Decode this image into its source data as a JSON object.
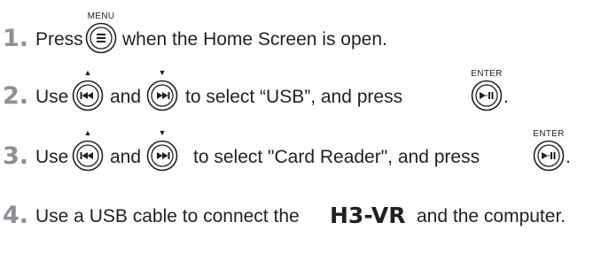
{
  "steps": [
    {
      "number": "1.",
      "text_a": "Press",
      "text_b": "when the Home Screen is open.",
      "button_label": "MENU"
    },
    {
      "number": "2.",
      "text_a": "Use",
      "text_b": "and",
      "text_c": "to select “USB”, and press",
      "text_d": ".",
      "button_label": "ENTER"
    },
    {
      "number": "3.",
      "text_a": "Use",
      "text_b": "and",
      "text_c": "to select \"Card Reader\", and press",
      "text_d": ".",
      "button_label": "ENTER"
    },
    {
      "number": "4.",
      "text_a": "Use a USB cable to connect the",
      "model": "H3-VR",
      "text_b": "and the computer."
    }
  ],
  "icons": {
    "menu": "menu-button-icon",
    "prev": "rewind-button-icon",
    "next": "fast-forward-button-icon",
    "play": "play-pause-button-icon",
    "up": "up-triangle-icon",
    "down": "down-triangle-icon"
  },
  "colors": {
    "number": "#8c9095",
    "text": "#231f20"
  }
}
